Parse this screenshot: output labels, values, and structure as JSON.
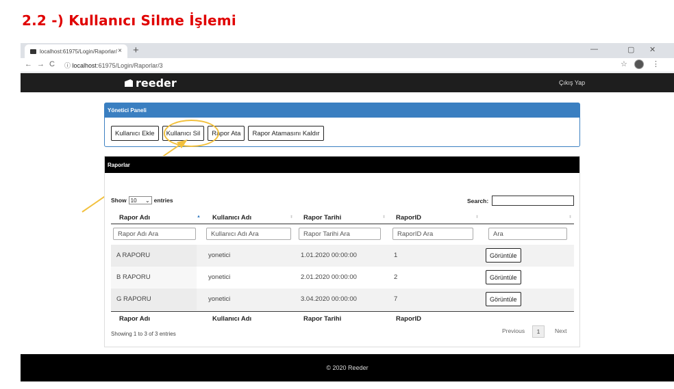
{
  "heading": "2.2 -) Kullanıcı Silme İşlemi",
  "browser": {
    "tab_title": "localhost:61975/Login/Raporlar/",
    "tab_close": "×",
    "new_tab": "+",
    "url_host": "localhost",
    "url_path": ":61975/Login/Raporlar/3",
    "back": "←",
    "forward": "→",
    "reload": "C",
    "info": "ⓘ",
    "star": "☆",
    "menu": "⋮",
    "minimize": "—",
    "maximize": "▢",
    "close": "✕"
  },
  "app": {
    "brand": "reeder",
    "logout": "Çıkış Yap",
    "admin_panel": {
      "title": "Yönetici Paneli",
      "buttons": [
        "Kullanıcı Ekle",
        "Kullanıcı Sil",
        "Rapor Ata",
        "Rapor Atamasını Kaldır"
      ]
    },
    "reports": {
      "title": "Raporlar",
      "show_prefix": "Show",
      "entries_value": "10",
      "show_suffix": "entries",
      "search_label": "Search:",
      "columns": [
        "Rapor Adı",
        "Kullanıcı Adı",
        "Rapor Tarihi",
        "RaporID"
      ],
      "filters": [
        "Rapor Adı Ara",
        "Kullanıcı Adı Ara",
        "Rapor Tarihi Ara",
        "RaporID Ara",
        "Ara"
      ],
      "rows": [
        {
          "name": "A RAPORU",
          "user": "yonetici",
          "date": "1.01.2020 00:00:00",
          "id": "1",
          "action": "Görüntüle"
        },
        {
          "name": "B RAPORU",
          "user": "yonetici",
          "date": "2.01.2020 00:00:00",
          "id": "2",
          "action": "Görüntüle"
        },
        {
          "name": "G RAPORU",
          "user": "yonetici",
          "date": "3.04.2020 00:00:00",
          "id": "7",
          "action": "Görüntüle"
        }
      ],
      "info": "Showing 1 to 3 of 3 entries",
      "previous": "Previous",
      "page": "1",
      "next": "Next"
    },
    "footer": "© 2020 Reeder"
  },
  "colors": {
    "heading": "#e00000",
    "panel_header": "#3a7fc1",
    "highlight": "#f2c03c",
    "navbar": "#1e1e1e"
  }
}
